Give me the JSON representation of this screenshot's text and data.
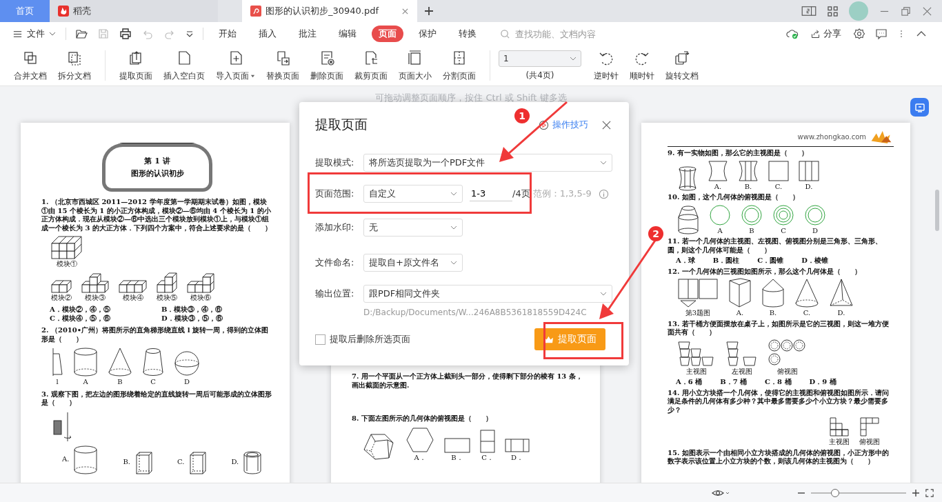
{
  "tabs": [
    {
      "kind": "home",
      "label": "首页",
      "selected": false
    },
    {
      "kind": "app",
      "label": "稻壳",
      "selected": false
    },
    {
      "kind": "doc",
      "label": "图形的认识初步_30940.pdf",
      "selected": true
    }
  ],
  "menu": {
    "file": "文件",
    "search": {
      "placeholder": "查找功能、文档内容"
    },
    "share": "分享",
    "tabs": [
      {
        "label": "开始",
        "selected": false
      },
      {
        "label": "插入",
        "selected": false
      },
      {
        "label": "批注",
        "selected": false
      },
      {
        "label": "编辑",
        "selected": false
      },
      {
        "label": "页面",
        "selected": true
      },
      {
        "label": "保护",
        "selected": false
      },
      {
        "label": "转换",
        "selected": false
      }
    ]
  },
  "ribbon": {
    "group_1": [
      {
        "label": "合并文档"
      },
      {
        "label": "拆分文档"
      }
    ],
    "group_2": [
      {
        "label": "提取页面",
        "dropdown": false
      },
      {
        "label": "插入空白页",
        "dropdown": false
      },
      {
        "label": "导入页面",
        "dropdown": true
      },
      {
        "label": "替换页面",
        "dropdown": false
      },
      {
        "label": "删除页面",
        "dropdown": false
      },
      {
        "label": "裁剪页面",
        "dropdown": false
      },
      {
        "label": "页面大小",
        "dropdown": false
      },
      {
        "label": "分割页面",
        "dropdown": false
      }
    ],
    "page_select": {
      "value": "1",
      "total": "(共4页)"
    },
    "group_3": [
      {
        "label": "逆时针"
      },
      {
        "label": "顺时针"
      },
      {
        "label": "旋转文档"
      }
    ]
  },
  "hint": "可拖动调整页面顺序，按住 Ctrl 或 Shift 键多选",
  "pages": [
    {
      "blocks": [
        {
          "kind": "banner",
          "title": "第 1 讲",
          "subtitle": "图形的认识初步"
        },
        {
          "kind": "question",
          "number": "1.",
          "text": "（北京市西城区 2011—2012 学年度第一学期期末试卷）如图，模块①由 15 个棱长为 1 的小正方体构成，模块②—⑥均由 4 个棱长为 1 的小正方体构成．现在从模块②—⑥中选出三个模块放到模块①上，与模块①组成一个棱长为 3 的大正方体．下列四个方案中，符合上述要求的是（　　）"
        },
        {
          "kind": "figures",
          "items": [
            {
              "kind": "cube-block",
              "label": "模块①"
            }
          ]
        },
        {
          "kind": "figures",
          "items": [
            {
              "kind": "cube-pair",
              "label": "模块②"
            },
            {
              "kind": "cube-step",
              "label": "模块③"
            },
            {
              "kind": "cube-row",
              "label": "模块④"
            },
            {
              "kind": "cube-corner",
              "label": "模块⑤"
            },
            {
              "kind": "cube-stair",
              "label": "模块⑥"
            }
          ]
        },
        {
          "kind": "options-two",
          "items": [
            "A．模块②，④，⑤",
            "B．模块③，④，⑥",
            "C．模块④，⑤，⑥",
            "D．模块③，⑤，⑥"
          ]
        },
        {
          "kind": "question",
          "number": "2.",
          "text": "（2010•广州）将图所示的直角梯形绕直线 l 旋转一周，得到的立体图形是（　　）"
        },
        {
          "kind": "figures",
          "items": [
            {
              "kind": "trapezoid",
              "label": "l"
            },
            {
              "kind": "cylinder",
              "label": "A"
            },
            {
              "kind": "cone",
              "label": "B"
            },
            {
              "kind": "frustum",
              "label": "C"
            },
            {
              "kind": "sphere",
              "label": "D"
            }
          ]
        },
        {
          "kind": "question",
          "number": "3.",
          "text": "观察下图，把左边的图形绕着给定的直线旋转一周后可能形成的立体图形是（　　）"
        },
        {
          "kind": "figures",
          "items": [
            {
              "kind": "rectangle-axis"
            }
          ]
        },
        {
          "kind": "figures-beside",
          "items": [
            {
              "kind": "cylinder",
              "label": "A."
            },
            {
              "kind": "box",
              "label": "B."
            },
            {
              "kind": "box",
              "label": "C."
            },
            {
              "kind": "tube",
              "label": "D."
            }
          ]
        }
      ]
    },
    {
      "blocks": [
        {
          "kind": "question",
          "number": "7.",
          "text": "用一个平面从一个正方体上截到头一部分，使得剩下部分的棱有 13 条，画出截面的示意图."
        },
        {
          "kind": "spacer"
        },
        {
          "kind": "question",
          "number": "8.",
          "text": "下面左图所示的几何体的俯视图是（　　）"
        },
        {
          "kind": "figures",
          "items": [
            {
              "kind": "hexagonal-prism"
            },
            {
              "kind": "hexagon",
              "label": "A．"
            },
            {
              "kind": "wide-rectangle",
              "label": "B．"
            },
            {
              "kind": "split-rectangle",
              "label": "C．"
            },
            {
              "kind": "three-part-rectangle",
              "label": "D．"
            }
          ]
        }
      ]
    },
    {
      "blocks": [
        {
          "kind": "header",
          "site": "www.zhongkao.com"
        },
        {
          "kind": "question",
          "number": "9.",
          "text": "有一实物如图，那么它的主视图是（　　）"
        },
        {
          "kind": "figures",
          "items": [
            {
              "kind": "spool"
            },
            {
              "kind": "concave",
              "label": "A."
            },
            {
              "kind": "concave-lines",
              "label": "B."
            },
            {
              "kind": "square",
              "label": "C."
            },
            {
              "kind": "three-part-square",
              "label": "D."
            }
          ]
        },
        {
          "kind": "question",
          "number": "10.",
          "text": "如图，这个几何体的俯视图是（　　）"
        },
        {
          "kind": "figures",
          "items": [
            {
              "kind": "cylinder-frustum"
            },
            {
              "kind": "circle",
              "label": "A"
            },
            {
              "kind": "double-ring",
              "label": "B"
            },
            {
              "kind": "triple-ring",
              "label": "C"
            },
            {
              "kind": "double-ring",
              "label": "D"
            }
          ]
        },
        {
          "kind": "question",
          "number": "11.",
          "text": "若一个几何体的主视图、左视图、俯视图分别是三角形、三角形、圆，则这个几何体可能是（　　）"
        },
        {
          "kind": "options-four",
          "items": [
            "A．球",
            "B．圆柱",
            "C．圆锥",
            "D．棱锥"
          ]
        },
        {
          "kind": "question",
          "number": "12.",
          "text": "一个几何体的三视图如图所示，那么这个几何体是（　　）"
        },
        {
          "kind": "figures",
          "items": [
            {
              "kind": "three-views",
              "label": "第3题图"
            },
            {
              "kind": "prism",
              "label": "A."
            },
            {
              "kind": "cylinder-cone",
              "label": "B."
            },
            {
              "kind": "cone",
              "label": "C."
            },
            {
              "kind": "pyramid",
              "label": "D."
            }
          ]
        },
        {
          "kind": "question",
          "number": "13.",
          "text": "若干桶方便面摆放在桌子上，如图所示是它的三视图，则这一堆方便面共有（　　）"
        },
        {
          "kind": "figures",
          "items": [
            {
              "kind": "bowls-front",
              "label": "主视图"
            },
            {
              "kind": "bowls-left",
              "label": "左视图"
            },
            {
              "kind": "bowls-top",
              "label": "俯视图"
            }
          ]
        },
        {
          "kind": "options-four",
          "items": [
            "A．6 桶",
            "B．7 桶",
            "C．8 桶",
            "D．9 桶"
          ]
        },
        {
          "kind": "question",
          "number": "14.",
          "text": "用小立方块搭一个几何体，使得它的主视图和俯视图如图所示．请问满足条件的几何体有多少种？其中最多需要多少个小立方块？最少需要多少？"
        },
        {
          "kind": "figures-right",
          "items": [
            {
              "kind": "grid-front",
              "label": "主视图"
            },
            {
              "kind": "grid-top",
              "label": "俯视图"
            }
          ]
        },
        {
          "kind": "question",
          "number": "15.",
          "text": "如图表示一个由相同小立方块搭成的几何体的俯视图，小正方形中的数字表示该位置上小立方块的个数，则该几何体的主视图为（　　）"
        }
      ]
    }
  ],
  "dialog": {
    "title": "提取页面",
    "help": "操作技巧",
    "mode": {
      "label": "提取模式:",
      "value": "将所选页提取为一个PDF文件"
    },
    "range": {
      "label": "页面范围:",
      "value": "自定义",
      "input": "1-3",
      "total": "/4页",
      "example": "范例：1,3,5-9"
    },
    "watermark": {
      "label": "添加水印:",
      "value": "无"
    },
    "naming": {
      "label": "文件命名:",
      "value": "提取自+原文件名"
    },
    "output": {
      "label": "输出位置:",
      "value": "跟PDF相同文件夹",
      "path": "D:/Backup/Documents/W...246A8B5361818559D424C"
    },
    "delete_after": {
      "label": "提取后删除所选页面",
      "checked": false
    },
    "submit": "提取页面"
  },
  "annotations": [
    {
      "number": "1"
    },
    {
      "number": "2"
    }
  ],
  "status_bar": {
    "zoom": {
      "level": 0.25
    }
  }
}
